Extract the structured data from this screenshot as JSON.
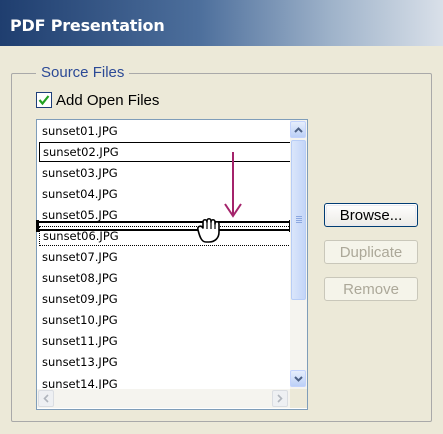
{
  "window": {
    "title": "PDF Presentation"
  },
  "source_files": {
    "legend": "Source Files",
    "add_open_files": {
      "label": "Add Open Files",
      "checked": true
    },
    "files": [
      "sunset01.JPG",
      "sunset02.JPG",
      "sunset03.JPG",
      "sunset04.JPG",
      "sunset05.JPG",
      "sunset06.JPG",
      "sunset07.JPG",
      "sunset08.JPG",
      "sunset09.JPG",
      "sunset10.JPG",
      "sunset11.JPG",
      "sunset13.JPG",
      "sunset14.JPG"
    ],
    "selected_file": "sunset02.JPG",
    "dragged_file": "sunset06.JPG",
    "buttons": {
      "browse": {
        "label": "Browse...",
        "enabled": true
      },
      "duplicate": {
        "label": "Duplicate",
        "enabled": false
      },
      "remove": {
        "label": "Remove",
        "enabled": false
      }
    }
  },
  "icons": {
    "drag_arrow": "down-arrow-icon",
    "cursor": "hand-cursor-icon",
    "checkbox": "checkmark-icon"
  },
  "colors": {
    "title_bar_dark": "#1f3e6f",
    "legend_text": "#2c4a96",
    "drag_arrow": "#a4236b",
    "window_bg": "#ece9d8"
  }
}
